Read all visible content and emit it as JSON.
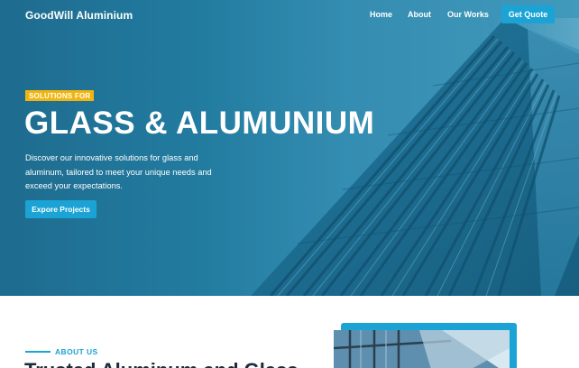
{
  "nav": {
    "brand": "GoodWill Aluminium",
    "links": [
      "Home",
      "About",
      "Our Works"
    ],
    "cta": "Get Quote"
  },
  "hero": {
    "badge": "SOLUTIONS FOR",
    "title": "GLASS & ALUMUNIUM",
    "description": "Discover our innovative solutions for glass and aluminum, tailored to meet your unique needs and exceed your expectations.",
    "button": "Expore Projects"
  },
  "about": {
    "label": "ABOUT US",
    "heading": "Trusted Aluminum and Glass"
  },
  "colors": {
    "accent": "#1aa3d4",
    "badge": "#f2b50f",
    "heading": "#1c2a3a"
  }
}
